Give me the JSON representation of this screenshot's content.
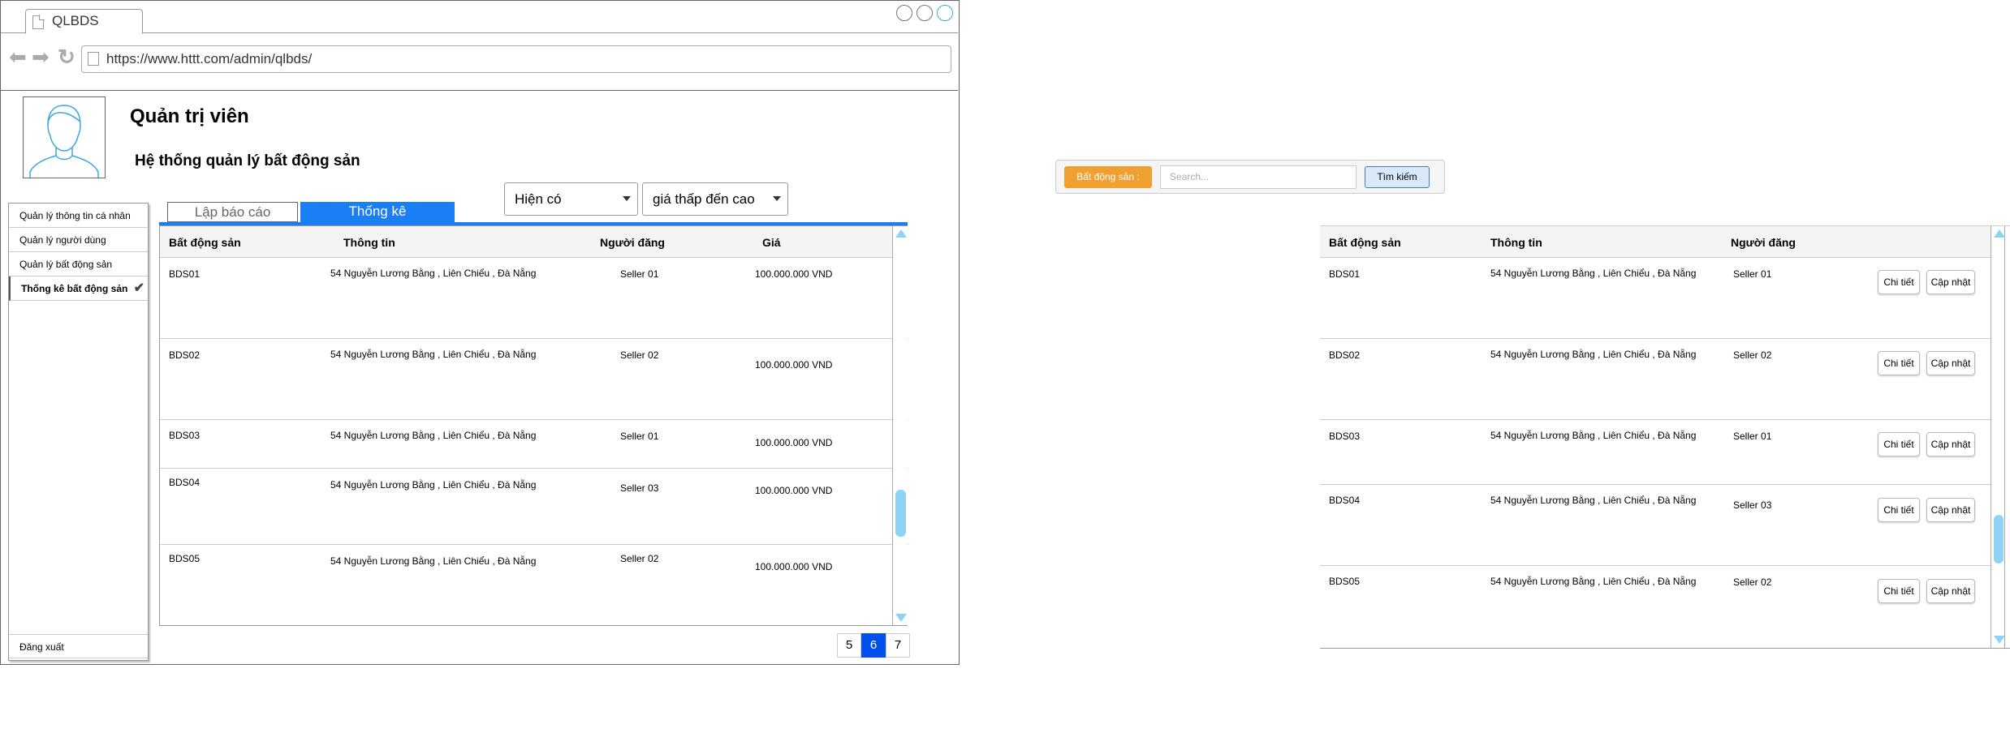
{
  "browser": {
    "tab_title": "QLBDS",
    "url": "https://www.httt.com/admin/qlbds/"
  },
  "header": {
    "role": "Quản trị viên",
    "system_title": "Hệ thống quản lý bất động sản"
  },
  "sidebar": {
    "items": [
      {
        "label": "Quản lý thông tin cá nhân"
      },
      {
        "label": "Quản lý người dùng"
      },
      {
        "label": "Quản lý bất động sản"
      },
      {
        "label": "Thống kê bất động sản"
      }
    ],
    "logout": "Đăng xuất"
  },
  "tabs": {
    "report": "Lập báo cáo",
    "stats": "Thống kê"
  },
  "filters": {
    "status": "Hiện có",
    "sort": "giá thấp đến cao"
  },
  "left_table": {
    "headers": [
      "Bất động sản",
      "Thông tin",
      "Người đăng",
      "Giá"
    ],
    "rows": [
      {
        "id": "BDS01",
        "info": "54 Nguyễn Lương Bằng , Liên Chiểu , Đà Nẵng",
        "seller": "Seller 01",
        "price": "100.000.000 VND"
      },
      {
        "id": "BDS02",
        "info": "54 Nguyễn Lương Bằng , Liên Chiểu , Đà Nẵng",
        "seller": "Seller 02",
        "price": "100.000.000 VND"
      },
      {
        "id": "BDS03",
        "info": "54 Nguyễn Lương Bằng , Liên Chiểu , Đà Nẵng",
        "seller": "Seller 01",
        "price": "100.000.000 VND"
      },
      {
        "id": "BDS04",
        "info": "54 Nguyễn Lương Bằng , Liên Chiểu , Đà Nẵng",
        "seller": "Seller 03",
        "price": "100.000.000 VND"
      },
      {
        "id": "BDS05",
        "info": "54 Nguyễn Lương Bằng , Liên Chiểu , Đà Nẵng",
        "seller": "Seller 02",
        "price": "100.000.000 VND"
      }
    ]
  },
  "pagination": {
    "pages": [
      "5",
      "6",
      "7"
    ],
    "current": "6"
  },
  "search": {
    "label": "Bất động sản :",
    "placeholder": "Search...",
    "button": "Tìm kiếm"
  },
  "right_table": {
    "headers": [
      "Bất động sản",
      "Thông tin",
      "Người đăng"
    ],
    "detail_label": "Chi tiết",
    "update_label": "Cập nhật",
    "rows": [
      {
        "id": "BDS01",
        "info": "54 Nguyễn Lương Bằng , Liên Chiểu , Đà Nẵng",
        "seller": "Seller 01"
      },
      {
        "id": "BDS02",
        "info": "54 Nguyễn Lương Bằng , Liên Chiểu , Đà Nẵng",
        "seller": "Seller 02"
      },
      {
        "id": "BDS03",
        "info": "54 Nguyễn Lương Bằng , Liên Chiểu , Đà Nẵng",
        "seller": "Seller 01"
      },
      {
        "id": "BDS04",
        "info": "54 Nguyễn Lương Bằng , Liên Chiểu , Đà Nẵng",
        "seller": "Seller 03"
      },
      {
        "id": "BDS05",
        "info": "54 Nguyễn Lương Bằng , Liên Chiểu , Đà Nẵng",
        "seller": "Seller 02"
      }
    ]
  },
  "colors": {
    "accent": "#1a7ff5",
    "page_active": "#0050ef",
    "search_label": "#f0a030",
    "search_button": "#dae8fc",
    "scroll": "#8ed3f5"
  },
  "icons": [
    "document-icon",
    "back-arrow-icon",
    "forward-arrow-icon",
    "refresh-icon",
    "user-avatar-icon",
    "check-icon",
    "caret-down-icon",
    "scroll-up-icon",
    "scroll-down-icon"
  ]
}
